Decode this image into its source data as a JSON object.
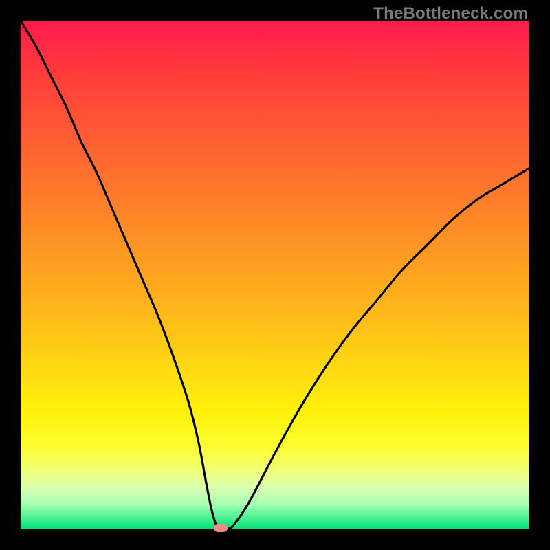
{
  "watermark": "TheBottleneck.com",
  "colors": {
    "frame": "#000000",
    "curve": "#000000",
    "dot": "#e98c86"
  },
  "chart_data": {
    "type": "line",
    "title": "",
    "xlabel": "",
    "ylabel": "",
    "xlim": [
      0,
      100
    ],
    "ylim": [
      0,
      100
    ],
    "grid": false,
    "legend": false,
    "series": [
      {
        "name": "bottleneck-curve",
        "x": [
          0,
          3,
          6,
          9,
          12,
          15,
          18,
          21,
          24,
          27,
          30,
          33,
          35,
          36.5,
          37.5,
          38.2,
          38.7,
          39.0,
          40.5,
          42,
          45,
          50,
          55,
          60,
          65,
          70,
          75,
          80,
          85,
          90,
          95,
          100
        ],
        "y": [
          100,
          95,
          89,
          83,
          76,
          70,
          63,
          56,
          49,
          42,
          34,
          25,
          17,
          9,
          4,
          1.5,
          0.3,
          0.0,
          0.0,
          1.0,
          5.5,
          15,
          24,
          32,
          39,
          45,
          51,
          56,
          61,
          65,
          68,
          71
        ]
      }
    ],
    "marker": {
      "x": 39.3,
      "y": 0
    }
  }
}
